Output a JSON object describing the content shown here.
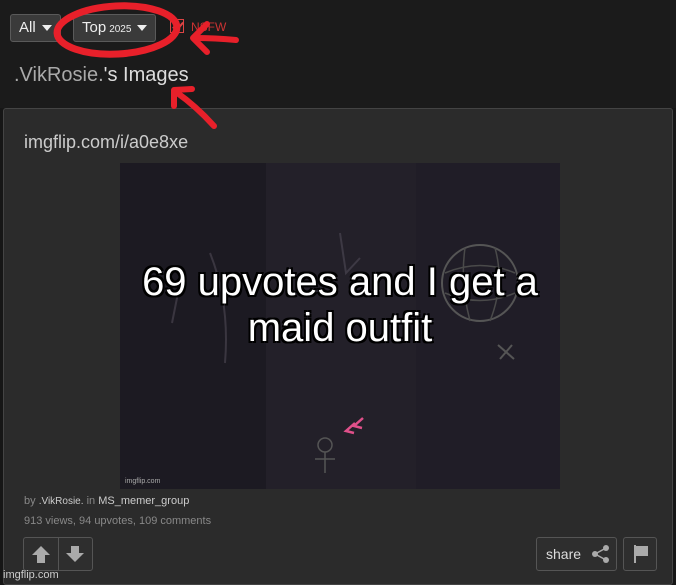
{
  "filters": {
    "all_label": "All",
    "top_label": "Top",
    "top_year": "2025",
    "nsfw_label": "NSFW",
    "nsfw_checked": true
  },
  "page": {
    "title_user": ".VikRosie.",
    "title_suffix": "'s Images"
  },
  "card": {
    "url": "imgflip.com/i/a0e8xe",
    "meme_text": "69 upvotes and I get a maid outfit",
    "meme_watermark": "imgflip.com",
    "by_prefix": "by",
    "author": ".VikRosie.",
    "in_prefix": "in",
    "group": "MS_memer_group",
    "stats": "913 views, 94 upvotes, 109 comments",
    "share_label": "share"
  },
  "watermark": "imgflip.com",
  "colors": {
    "annotation_red": "#e8202a",
    "accent_pink": "#e0508a",
    "page_background": "#161616",
    "card_background": "#2b2b2b"
  },
  "icons": [
    "caret-down-icon",
    "checkbox-icon",
    "upvote-arrow-icon",
    "downvote-arrow-icon",
    "share-icon",
    "flag-icon",
    "annotation-circle",
    "annotation-arrow"
  ]
}
